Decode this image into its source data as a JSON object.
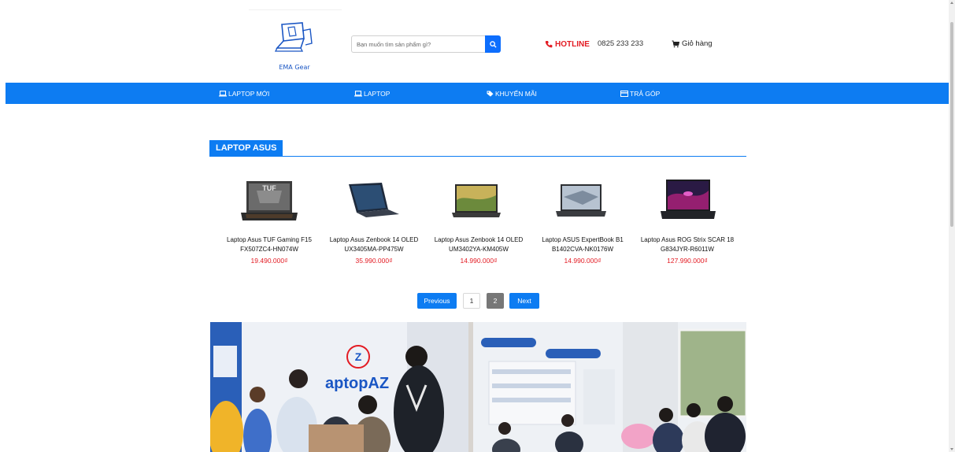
{
  "header": {
    "logo_text": "EMA Gear",
    "search_placeholder": "Bạn muốn tìm sản phẩm gì?",
    "hotline_label": "HOTLINE",
    "phone": "0825 233 233",
    "cart_label": "Giỏ hàng"
  },
  "nav": {
    "items": [
      {
        "label": "LAPTOP MỚI",
        "icon": "laptop-icon"
      },
      {
        "label": "LAPTOP",
        "icon": "laptop-icon"
      },
      {
        "label": "KHUYẾN MÃI",
        "icon": "tag-icon"
      },
      {
        "label": "TRẢ GÓP",
        "icon": "credit-card-icon"
      }
    ]
  },
  "section": {
    "title": "LAPTOP ASUS"
  },
  "products": [
    {
      "name_line1": "Laptop Asus TUF Gaming F15",
      "name_line2": "FX507ZC4-HN074W",
      "price": "19.490.000₫"
    },
    {
      "name_line1": "Laptop Asus Zenbook 14 OLED",
      "name_line2": "UX3405MA-PP475W",
      "price": "35.990.000₫"
    },
    {
      "name_line1": "Laptop Asus Zenbook 14 OLED",
      "name_line2": "UM3402YA-KM405W",
      "price": "14.990.000₫"
    },
    {
      "name_line1": "Laptop ASUS ExpertBook B1",
      "name_line2": "B1402CVA-NK0176W",
      "price": "14.990.000₫"
    },
    {
      "name_line1": "Laptop Asus ROG Strix SCAR 18",
      "name_line2": "G834JYR-R6011W",
      "price": "127.990.000₫"
    }
  ],
  "pagination": {
    "previous": "Previous",
    "page1": "1",
    "page2": "2",
    "next": "Next"
  },
  "store_photos": {
    "sign_text": "aptopAZ",
    "logo_letter": "Z"
  },
  "colors": {
    "accent": "#0d7cf2",
    "price": "#e31b23"
  }
}
